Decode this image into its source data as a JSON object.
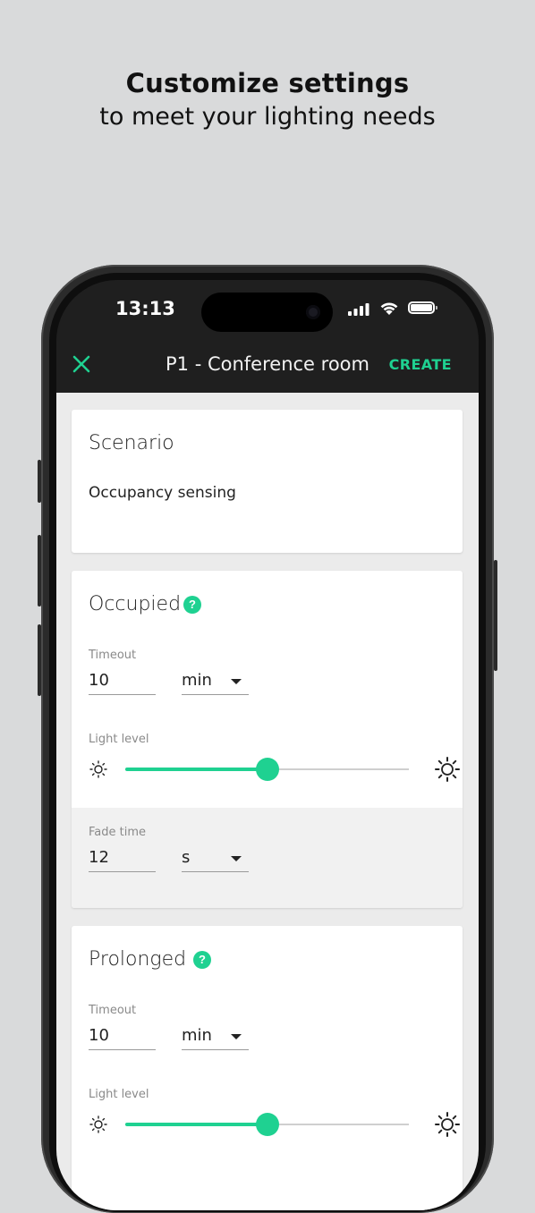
{
  "headline": {
    "title": "Customize settings",
    "subtitle": "to meet your lighting needs"
  },
  "status_bar": {
    "time": "13:13",
    "icons": [
      "cellular-signal-icon",
      "wifi-icon",
      "battery-icon"
    ]
  },
  "app_bar": {
    "close_icon": "close-icon",
    "title": "P1 - Conference room",
    "action_label": "CREATE"
  },
  "colors": {
    "accent": "#1fd191",
    "app_bar_bg": "#1f1f1f",
    "page_bg": "#d9dadb",
    "content_bg": "#ebebeb"
  },
  "scenario": {
    "title": "Scenario",
    "value": "Occupancy sensing"
  },
  "occupied": {
    "title": "Occupied",
    "help_icon": "?",
    "timeout_label": "Timeout",
    "timeout_value": "10",
    "timeout_unit": "min",
    "light_level_label": "Light level",
    "light_level_fraction": 0.5,
    "fade_time_label": "Fade time",
    "fade_time_value": "12",
    "fade_time_unit": "s"
  },
  "prolonged": {
    "title": "Prolonged",
    "help_icon": "?",
    "timeout_label": "Timeout",
    "timeout_value": "10",
    "timeout_unit": "min",
    "light_level_label": "Light level",
    "light_level_fraction": 0.5
  }
}
